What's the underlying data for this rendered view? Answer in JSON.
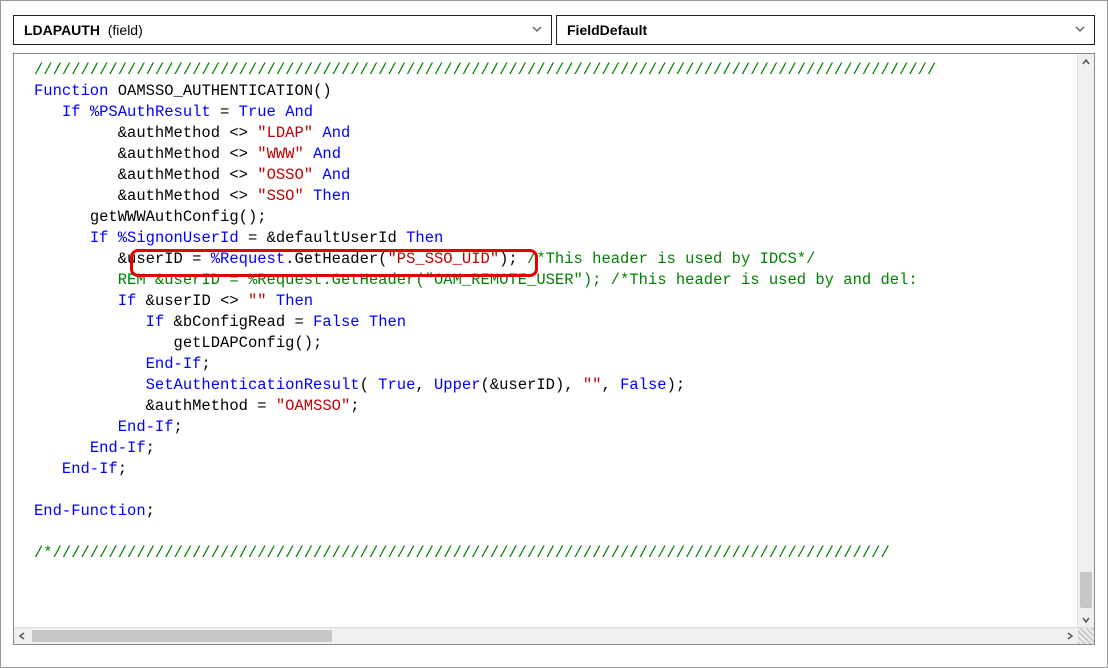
{
  "dropdowns": {
    "left_bold": "LDAPAUTH",
    "left_paren": "(field)",
    "right": "FieldDefault"
  },
  "code": {
    "slashline": "/////////////////////////////////////////////////////////////////////////////////////////////////",
    "fn_name": "OAMSSO_AUTHENTICATION",
    "ps_auth": "%PSAuthResult",
    "true": "True",
    "and": "And",
    "amp_authMethod": "&authMethod",
    "ldap": "\"LDAP\"",
    "www_s": "\"WWW\"",
    "osso": "\"OSSO\"",
    "sso_s": "\"SSO\"",
    "then": "Then",
    "getW": "getWWWAuthConfig();",
    "signon": "%SignonUserId",
    "defUser": "&defaultUserId",
    "userID": "&userID",
    "request": "%Request",
    "getHeader": ".GetHeader(",
    "ps_sso": "\"PS_SSO_UID\"",
    "idcs_comment": "/*This header is used by IDCS*/",
    "rem_line_1": "REM ",
    "rem_line_2": "&userID = ",
    "rem_line_3": "%Request",
    "rem_line_4": ".GetHeader(",
    "oam_remote": "\"OAM_REMOTE_USER\"",
    "rem_line_5": "); ",
    "rem_line_comment2": "/*This header is used by and del:",
    "empty": "\"\"",
    "bconf": "&bConfigRead",
    "false": "False",
    "getL": "getLDAPConfig();",
    "endif": "End-If",
    "setAuth": "SetAuthenticationResult",
    "upper": "Upper",
    "oamsso": "\"OAMSSO\"",
    "endfn": "End-Function",
    "tail_comment": "/*//////////////////////////////////////////////////////////////////////////////////////////"
  }
}
